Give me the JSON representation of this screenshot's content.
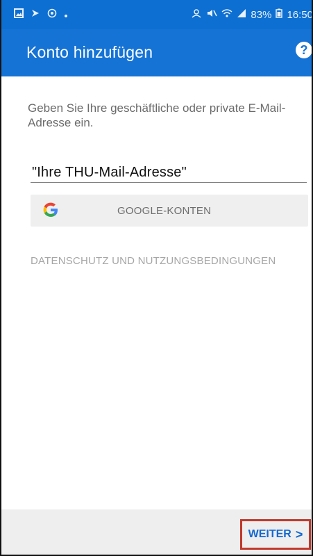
{
  "status_bar": {
    "left_icons": [
      "image-icon",
      "forward-icon",
      "target-icon",
      "dot-icon"
    ],
    "battery_percent": "83%",
    "time": "16:50"
  },
  "app_bar": {
    "title": "Konto hinzufügen",
    "help_glyph": "?"
  },
  "main": {
    "instruction": "Geben Sie Ihre geschäftliche oder private E-Mail-Adresse ein.",
    "email_value": "\"Ihre THU-Mail-Adresse\"",
    "google_button_label": "GOOGLE-KONTEN",
    "privacy_link": "DATENSCHUTZ UND NUTZUNGSBEDINGUNGEN"
  },
  "footer": {
    "next_label": "WEITER",
    "next_chevron": ">"
  },
  "colors": {
    "primary": "#1573d6",
    "highlight_border": "#c0392b"
  }
}
